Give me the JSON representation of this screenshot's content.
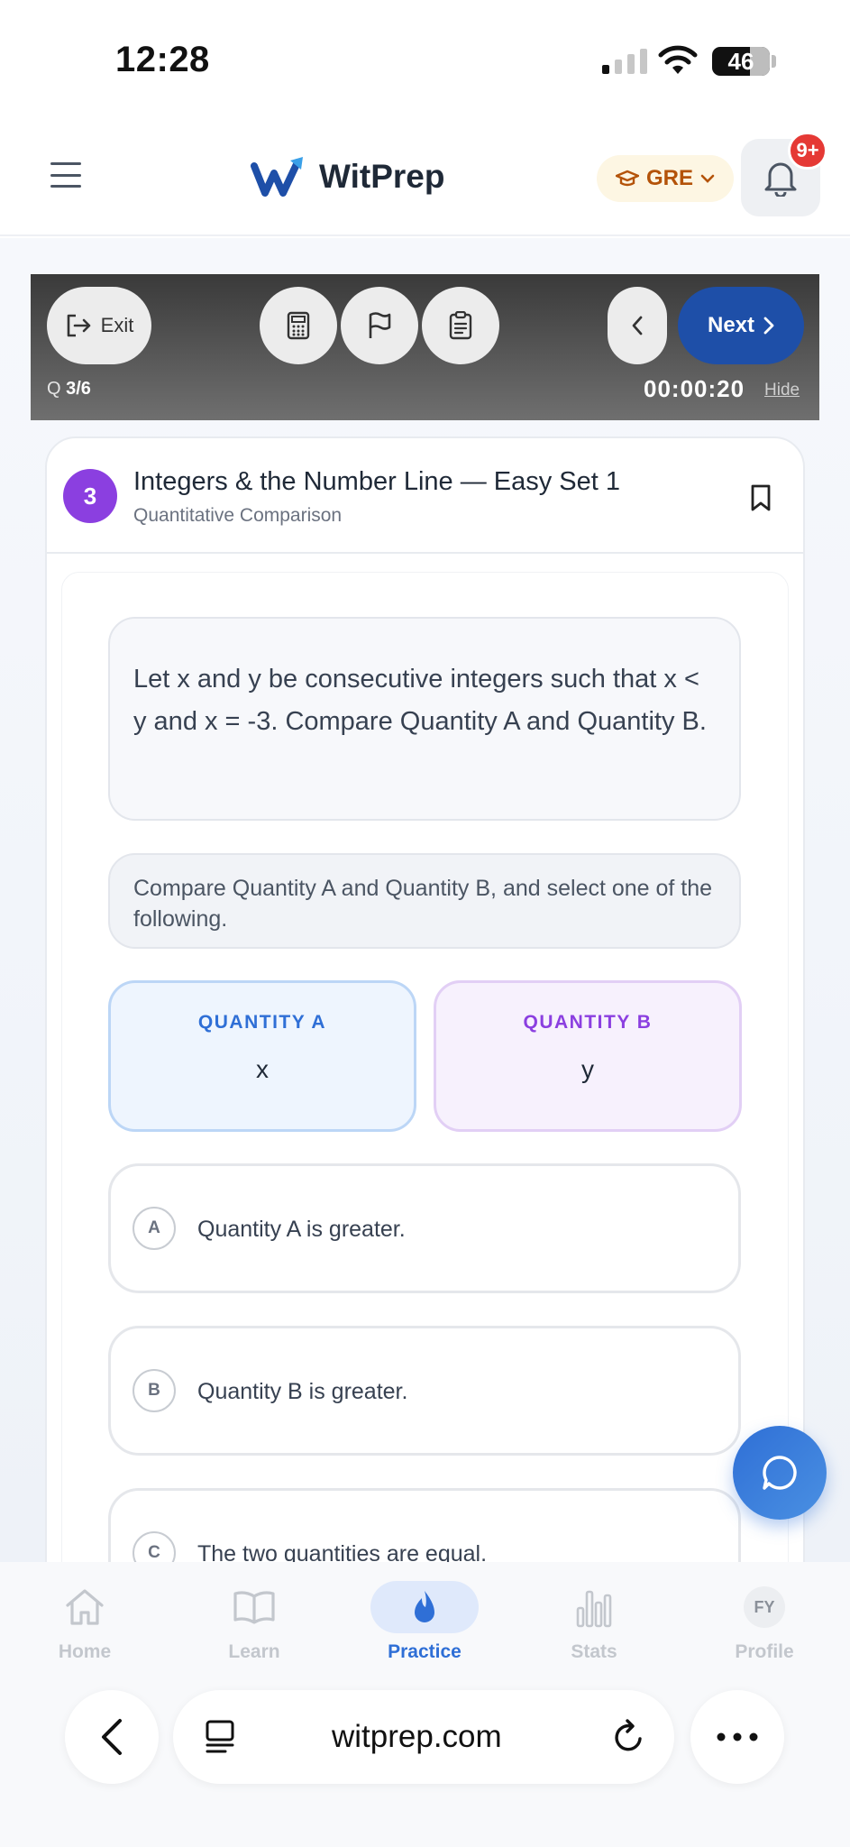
{
  "status_bar": {
    "time": "12:28",
    "battery": "46"
  },
  "header": {
    "brand": "WitPrep",
    "exam": "GRE",
    "notifications": "9+"
  },
  "toolbar": {
    "exit_label": "Exit",
    "next_label": "Next",
    "question_prefix": "Q ",
    "question_position": "3/6",
    "timer": "00:00:20",
    "hide_label": "Hide"
  },
  "question": {
    "number": "3",
    "title": "Integers & the Number Line — Easy Set 1",
    "type": "Quantitative Comparison",
    "stem": "Let x and y be consecutive integers such that x < y and x = -3. Compare Quantity A and Quantity B.",
    "instruction": "Compare Quantity A and Quantity B, and select one of the following.",
    "quantity_a": {
      "label": "QUANTITY A",
      "value": "x"
    },
    "quantity_b": {
      "label": "QUANTITY B",
      "value": "y"
    },
    "options": [
      {
        "letter": "A",
        "text": "Quantity A is greater."
      },
      {
        "letter": "B",
        "text": "Quantity B is greater."
      },
      {
        "letter": "C",
        "text": "The two quantities are equal."
      }
    ]
  },
  "nav": {
    "items": [
      {
        "label": "Home",
        "icon": "home-icon"
      },
      {
        "label": "Learn",
        "icon": "book-icon"
      },
      {
        "label": "Practice",
        "icon": "flame-icon",
        "active": true
      },
      {
        "label": "Stats",
        "icon": "bar-chart-icon"
      },
      {
        "label": "Profile",
        "icon": "avatar",
        "initials": "FY"
      }
    ]
  },
  "browser": {
    "url": "witprep.com"
  },
  "colors": {
    "accent": "#2f6fd6",
    "purple": "#8b3fe0",
    "next_button": "#1e4fa8",
    "badge": "#e53935"
  }
}
